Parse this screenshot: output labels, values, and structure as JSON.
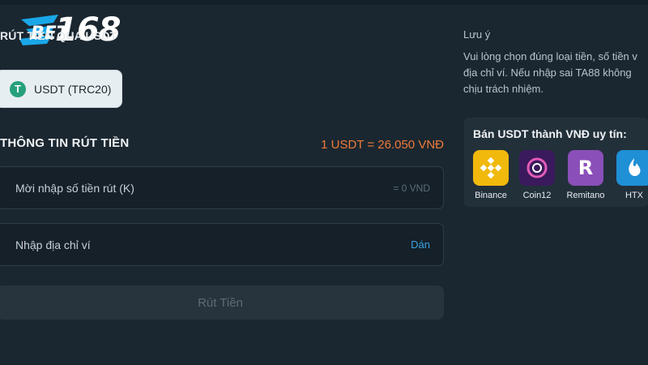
{
  "brand": {
    "logo_text": "168",
    "logo_prefix": "BET"
  },
  "withdraw": {
    "section_title": "RÚT TIỀN QUA USDT",
    "currency_label": "USDT (TRC20)",
    "info_title": "THÔNG TIN RÚT TIỀN",
    "rate": "1 USDT = 26.050 VNĐ",
    "amount_placeholder": "Mời nhập số tiền rút (K)",
    "amount_suffix": "= 0 VND",
    "wallet_placeholder": "Nhập địa chỉ ví",
    "paste_label": "Dán",
    "submit_label": "Rút Tiền"
  },
  "note": {
    "title": "Lưu ý",
    "lines": [
      "Vui lòng chọn đúng loại tiền, số tiền v",
      "địa chỉ ví. Nếu nhập sai TA88 không",
      "chịu trách nhiệm."
    ]
  },
  "exchanges": {
    "title": "Bán USDT thành VNĐ uy tín:",
    "items": [
      {
        "name": "Binance",
        "icon": "binance-icon",
        "color": "#f0b90b"
      },
      {
        "name": "Coin12",
        "icon": "coin12-icon",
        "color": "#3a1a5c"
      },
      {
        "name": "Remitano",
        "icon": "remitano-icon",
        "color": "#8a4fb8"
      },
      {
        "name": "HTX",
        "icon": "htx-icon",
        "color": "#1f8fd6"
      }
    ]
  },
  "colors": {
    "accent": "#f07a3a",
    "link": "#3aa3e0",
    "background": "#1b2730"
  }
}
